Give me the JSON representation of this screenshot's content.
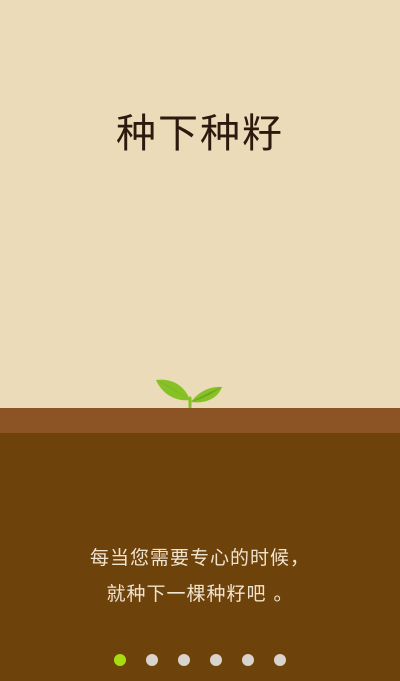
{
  "onboarding": {
    "title": "种下种籽",
    "description_line1": "每当您需要专心的时候，",
    "description_line2": "就种下一棵种籽吧 。",
    "illustration_icon": "sprout-icon"
  },
  "pagination": {
    "total_pages": 6,
    "current_page": 1,
    "active_color": "#a6dd10",
    "inactive_color": "#d9d3cc"
  },
  "colors": {
    "background": "#ecdbb9",
    "soil_top": "#8c5325",
    "soil": "#6e420b",
    "title_text": "#2b1a0d",
    "description_text": "#f1e4cf",
    "leaf": "#86c226"
  }
}
